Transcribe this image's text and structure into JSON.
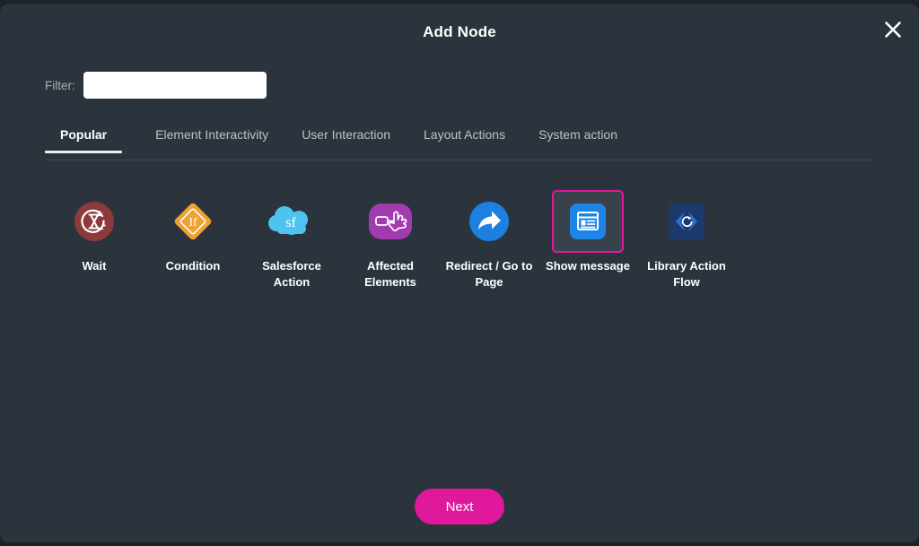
{
  "dialog": {
    "title": "Add Node",
    "close_icon": "close-icon"
  },
  "filter": {
    "label": "Filter:",
    "value": "",
    "placeholder": ""
  },
  "tabs": [
    {
      "label": "Popular",
      "active": true
    },
    {
      "label": "Element Interactivity",
      "active": false
    },
    {
      "label": "User Interaction",
      "active": false
    },
    {
      "label": "Layout Actions",
      "active": false
    },
    {
      "label": "System action",
      "active": false
    }
  ],
  "nodes": [
    {
      "label": "Wait",
      "icon": "hourglass-refresh-icon",
      "selected": false
    },
    {
      "label": "Condition",
      "icon": "diamond-if-icon",
      "selected": false
    },
    {
      "label": "Salesforce Action",
      "icon": "salesforce-cloud-icon",
      "selected": false
    },
    {
      "label": "Affected Elements",
      "icon": "hand-pointer-icon",
      "selected": false
    },
    {
      "label": "Redirect / Go to Page",
      "icon": "share-arrow-icon",
      "selected": false
    },
    {
      "label": "Show message",
      "icon": "message-window-icon",
      "selected": true
    },
    {
      "label": "Library Action Flow",
      "icon": "code-brackets-icon",
      "selected": false
    }
  ],
  "footer": {
    "next_label": "Next"
  },
  "colors": {
    "dialog_background": "#2b343c",
    "page_background": "#1b2228",
    "accent_magenta": "#e0189c",
    "wait_icon": "#8c3a3c",
    "condition_icon": "#efa133",
    "salesforce_icon": "#4ec3f0",
    "affected_icon": "#a23bb0",
    "redirect_icon": "#1d7fe0",
    "show_message_icon": "#1d84e8",
    "library_icon": "#1b3a6b"
  }
}
